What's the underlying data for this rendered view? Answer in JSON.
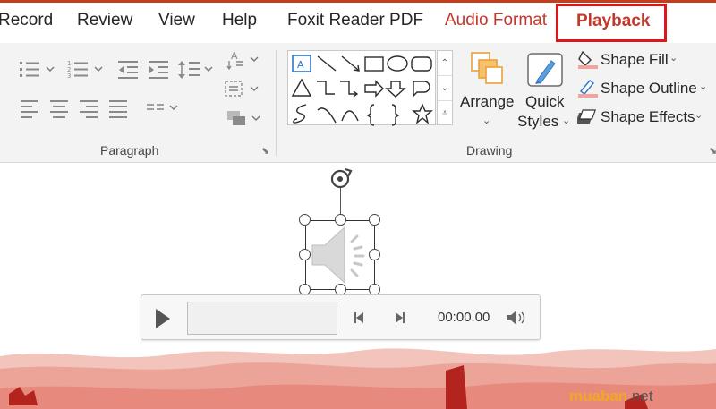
{
  "tabs": [
    {
      "label": "Record"
    },
    {
      "label": "Review"
    },
    {
      "label": "View"
    },
    {
      "label": "Help"
    },
    {
      "label": "Foxit Reader PDF"
    },
    {
      "label": "Audio Format"
    },
    {
      "label": "Playback"
    }
  ],
  "ribbon": {
    "paragraph": {
      "label": "Paragraph"
    },
    "drawing": {
      "label": "Drawing",
      "arrange_label": "Arrange",
      "quick_styles_line1": "Quick",
      "quick_styles_line2": "Styles",
      "shape_fill_label": "Shape Fill",
      "shape_outline_label": "Shape Outline",
      "shape_effects_label": "Shape Effects"
    }
  },
  "player": {
    "time": "00:00.00"
  },
  "watermark": {
    "brand": "muaban",
    "tld": ".net"
  },
  "colors": {
    "accent": "#c0392b",
    "highlight_box": "#e0151b",
    "fill_swatch": "#f4a29a"
  }
}
